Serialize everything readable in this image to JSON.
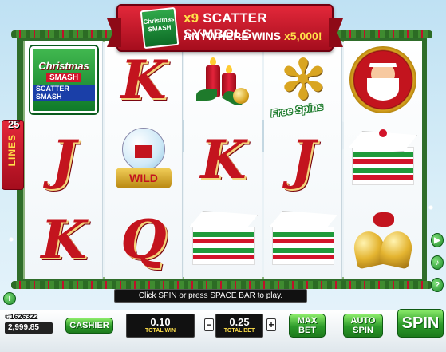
{
  "banner": {
    "logo_line1": "Christmas",
    "logo_line2": "SMASH",
    "count_text": "x9",
    "line1": "SCATTER SYMBOLS",
    "line2_prefix": "ANYWHERE WINS",
    "line2_value": "x5,000!"
  },
  "lines": {
    "count": "25",
    "label": "LINES"
  },
  "reels": [
    {
      "symbols": [
        "logo",
        "J",
        "K"
      ]
    },
    {
      "symbols": [
        "K",
        "wild",
        "Q"
      ]
    },
    {
      "symbols": [
        "candles",
        "K",
        "cake"
      ]
    },
    {
      "symbols": [
        "free-spins",
        "J",
        "cake"
      ]
    },
    {
      "symbols": [
        "santa",
        "cake",
        "bells"
      ]
    }
  ],
  "symbols": {
    "logo": {
      "line1": "Christmas",
      "line2": "SMASH",
      "line3": "SCATTER SMASH"
    },
    "wild_label": "WILD",
    "free_spins_label": "Free Spins"
  },
  "message": "Click SPIN or press SPACE BAR to play.",
  "account": {
    "id": "©1626322",
    "balance": "2,999.85"
  },
  "controls": {
    "cashier": "CASHIER",
    "total_win_value": "0.10",
    "total_win_label": "TOTAL WIN",
    "minus": "−",
    "total_bet_value": "0.25",
    "total_bet_label": "TOTAL BET",
    "plus": "+",
    "max_bet": "MAX BET",
    "auto_spin": "AUTO SPIN",
    "spin": "SPIN"
  },
  "side_icons": [
    "arrow-right-icon",
    "sound-icon",
    "info-icon"
  ]
}
